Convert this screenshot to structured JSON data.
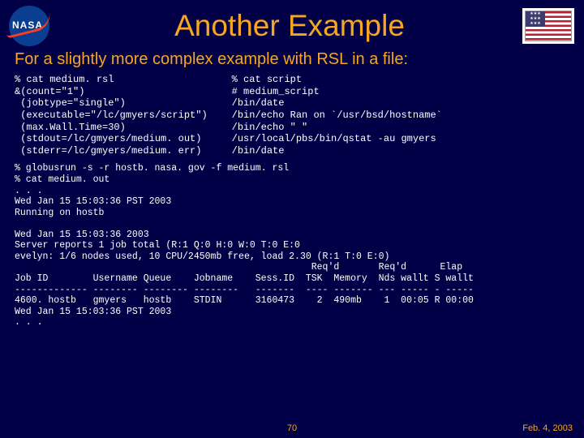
{
  "header": {
    "logo_text": "NASA",
    "title": "Another Example"
  },
  "subtitle": "For a slightly more complex example with RSL in a file:",
  "code_left": "% cat medium. rsl\n&(count=\"1\")\n (jobtype=\"single\")\n (executable=\"/lc/gmyers/script\")\n (max.Wall.Time=30)\n (stdout=/lc/gmyers/medium. out)\n (stderr=/lc/gmyers/medium. err)",
  "code_right": "% cat script\n# medium_script\n/bin/date\n/bin/echo Ran on `/usr/bsd/hostname`\n/bin/echo \" \"\n/usr/local/pbs/bin/qstat -au gmyers\n/bin/date",
  "code_output": "% globusrun -s -r hostb. nasa. gov -f medium. rsl\n% cat medium. out\n. . .\nWed Jan 15 15:03:36 PST 2003\nRunning on hostb\n\nWed Jan 15 15:03:36 2003\nServer reports 1 job total (R:1 Q:0 H:0 W:0 T:0 E:0\nevelyn: 1/6 nodes used, 10 CPU/2450mb free, load 2.30 (R:1 T:0 E:0)\n                                                     Req'd       Req'd      Elap\nJob ID        Username Queue    Jobname    Sess.ID  TSK  Memory  Nds wallt S wallt\n------------- -------- -------- --------   -------  ---- ------- --- ----- - -----\n4600. hostb   gmyers   hostb    STDIN      3160473    2  490mb    1  00:05 R 00:00\nWed Jan 15 15:03:36 PST 2003\n. . .",
  "footer": {
    "page": "70",
    "date": "Feb. 4, 2003"
  }
}
